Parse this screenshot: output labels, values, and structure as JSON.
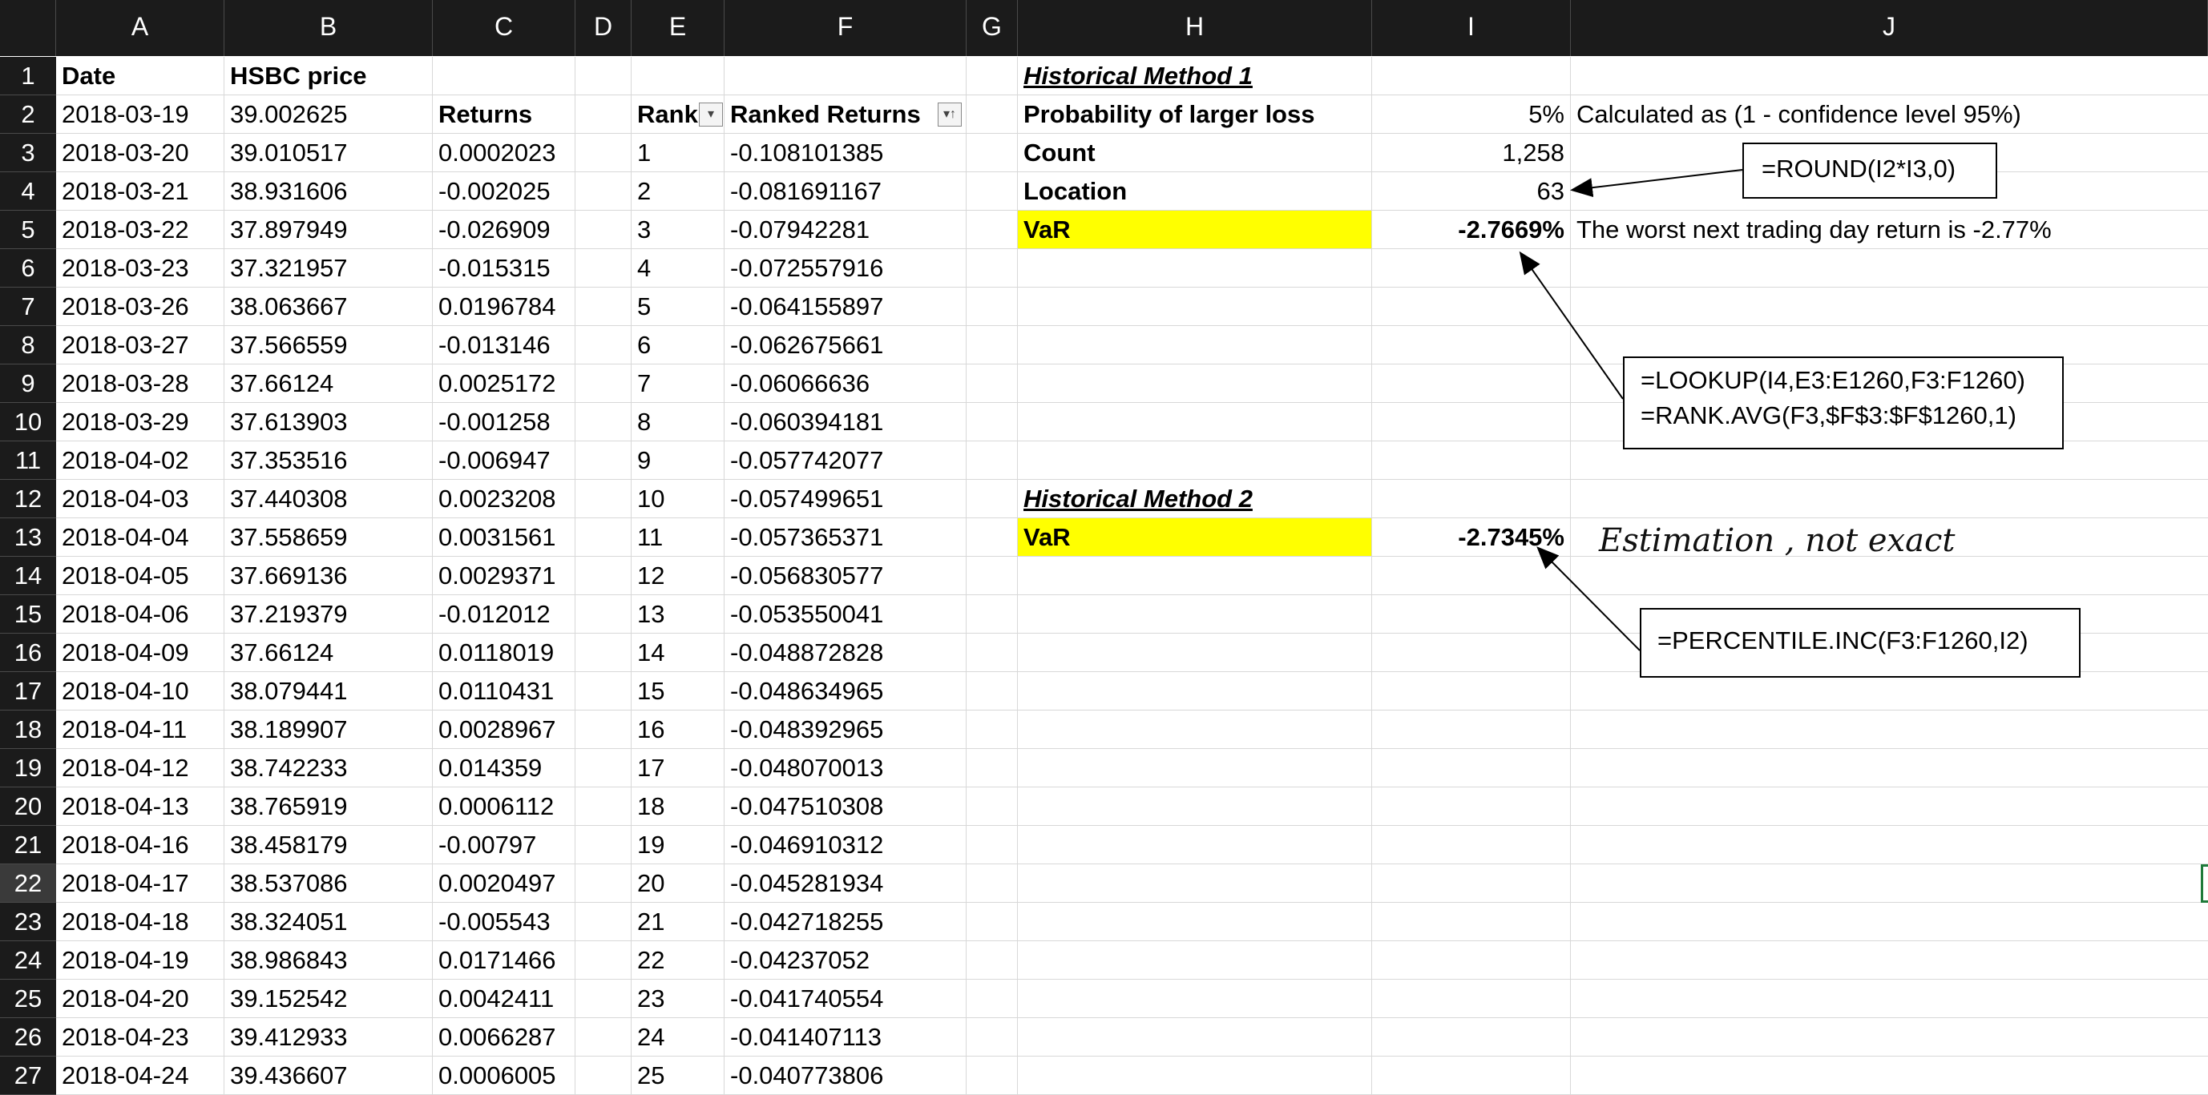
{
  "columns": [
    "A",
    "B",
    "C",
    "D",
    "E",
    "F",
    "G",
    "H",
    "I",
    "J"
  ],
  "rows_numbers": [
    "1",
    "2",
    "3",
    "4",
    "5",
    "6",
    "7",
    "8",
    "9",
    "10",
    "11",
    "12",
    "13",
    "14",
    "15",
    "16",
    "17",
    "18",
    "19",
    "20",
    "21",
    "22",
    "23",
    "24",
    "25",
    "26",
    "27"
  ],
  "headers_row1": {
    "A": "Date",
    "B": "HSBC price"
  },
  "headers_row2": {
    "C": "Returns",
    "E": "Rank",
    "F": "Ranked Returns"
  },
  "data_rows": [
    {
      "date": "2018-03-19",
      "price": "39.002625",
      "ret": "",
      "rank": "",
      "ranked": ""
    },
    {
      "date": "2018-03-20",
      "price": "39.010517",
      "ret": "0.0002023",
      "rank": "1",
      "ranked": "-0.108101385"
    },
    {
      "date": "2018-03-21",
      "price": "38.931606",
      "ret": "-0.002025",
      "rank": "2",
      "ranked": "-0.081691167"
    },
    {
      "date": "2018-03-22",
      "price": "37.897949",
      "ret": "-0.026909",
      "rank": "3",
      "ranked": "-0.07942281"
    },
    {
      "date": "2018-03-23",
      "price": "37.321957",
      "ret": "-0.015315",
      "rank": "4",
      "ranked": "-0.072557916"
    },
    {
      "date": "2018-03-26",
      "price": "38.063667",
      "ret": "0.0196784",
      "rank": "5",
      "ranked": "-0.064155897"
    },
    {
      "date": "2018-03-27",
      "price": "37.566559",
      "ret": "-0.013146",
      "rank": "6",
      "ranked": "-0.062675661"
    },
    {
      "date": "2018-03-28",
      "price": "37.66124",
      "ret": "0.0025172",
      "rank": "7",
      "ranked": "-0.06066636"
    },
    {
      "date": "2018-03-29",
      "price": "37.613903",
      "ret": "-0.001258",
      "rank": "8",
      "ranked": "-0.060394181"
    },
    {
      "date": "2018-04-02",
      "price": "37.353516",
      "ret": "-0.006947",
      "rank": "9",
      "ranked": "-0.057742077"
    },
    {
      "date": "2018-04-03",
      "price": "37.440308",
      "ret": "0.0023208",
      "rank": "10",
      "ranked": "-0.057499651"
    },
    {
      "date": "2018-04-04",
      "price": "37.558659",
      "ret": "0.0031561",
      "rank": "11",
      "ranked": "-0.057365371"
    },
    {
      "date": "2018-04-05",
      "price": "37.669136",
      "ret": "0.0029371",
      "rank": "12",
      "ranked": "-0.056830577"
    },
    {
      "date": "2018-04-06",
      "price": "37.219379",
      "ret": "-0.012012",
      "rank": "13",
      "ranked": "-0.053550041"
    },
    {
      "date": "2018-04-09",
      "price": "37.66124",
      "ret": "0.0118019",
      "rank": "14",
      "ranked": "-0.048872828"
    },
    {
      "date": "2018-04-10",
      "price": "38.079441",
      "ret": "0.0110431",
      "rank": "15",
      "ranked": "-0.048634965"
    },
    {
      "date": "2018-04-11",
      "price": "38.189907",
      "ret": "0.0028967",
      "rank": "16",
      "ranked": "-0.048392965"
    },
    {
      "date": "2018-04-12",
      "price": "38.742233",
      "ret": "0.014359",
      "rank": "17",
      "ranked": "-0.048070013"
    },
    {
      "date": "2018-04-13",
      "price": "38.765919",
      "ret": "0.0006112",
      "rank": "18",
      "ranked": "-0.047510308"
    },
    {
      "date": "2018-04-16",
      "price": "38.458179",
      "ret": "-0.00797",
      "rank": "19",
      "ranked": "-0.046910312"
    },
    {
      "date": "2018-04-17",
      "price": "38.537086",
      "ret": "0.0020497",
      "rank": "20",
      "ranked": "-0.045281934"
    },
    {
      "date": "2018-04-18",
      "price": "38.324051",
      "ret": "-0.005543",
      "rank": "21",
      "ranked": "-0.042718255"
    },
    {
      "date": "2018-04-19",
      "price": "38.986843",
      "ret": "0.0171466",
      "rank": "22",
      "ranked": "-0.04237052"
    },
    {
      "date": "2018-04-20",
      "price": "39.152542",
      "ret": "0.0042411",
      "rank": "23",
      "ranked": "-0.041740554"
    },
    {
      "date": "2018-04-23",
      "price": "39.412933",
      "ret": "0.0066287",
      "rank": "24",
      "ranked": "-0.041407113"
    },
    {
      "date": "2018-04-24",
      "price": "39.436607",
      "ret": "0.0006005",
      "rank": "25",
      "ranked": "-0.040773806"
    }
  ],
  "method1": {
    "title": "Historical Method 1",
    "prob_label": "Probability of larger loss",
    "prob_value": "5%",
    "prob_note": "Calculated as (1 - confidence level 95%)",
    "count_label": "Count",
    "count_value": "1,258",
    "location_label": "Location",
    "location_value": "63",
    "var_label": "VaR",
    "var_value": "-2.7669%",
    "var_note": "The worst next trading day return is -2.77%"
  },
  "method2": {
    "title": "Historical Method 2",
    "var_label": "VaR",
    "var_value": "-2.7345%",
    "handwritten_note": "Estimation , not exact"
  },
  "notes": {
    "round_formula": "=ROUND(I2*I3,0)",
    "lookup_formula": "=LOOKUP(I4,E3:E1260,F3:F1260)",
    "rank_formula": "=RANK.AVG(F3,$F$3:$F$1260,1)",
    "percentile_formula": "=PERCENTILE.INC(F3:F1260,I2)"
  },
  "colors": {
    "highlight": "#ffff00",
    "header_bg": "#1b1b1b"
  },
  "active_row": "22",
  "icons": {
    "rank_filter": "filter-dropdown-icon",
    "ranked_sort": "sort-ascending-icon"
  }
}
